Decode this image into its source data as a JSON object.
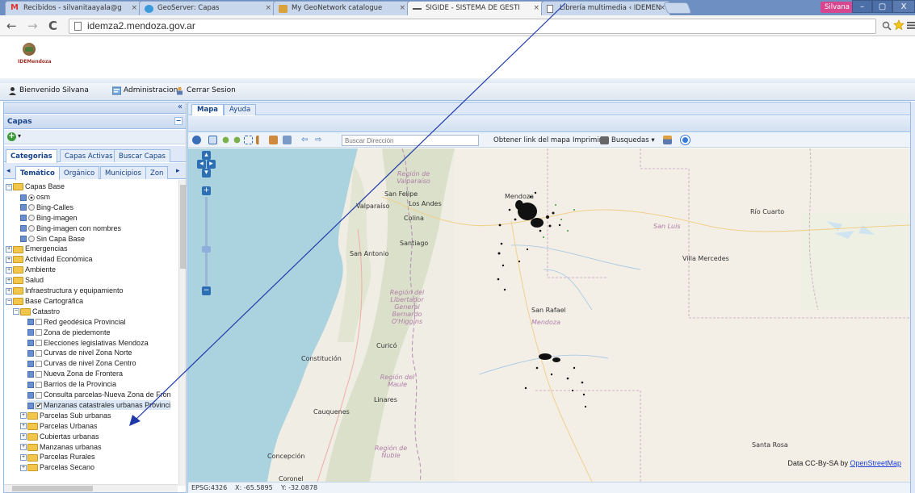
{
  "browser": {
    "tabs": [
      {
        "title": "Recibidos - silvanitaayala@g",
        "icon": "gmail-icon",
        "close": "×"
      },
      {
        "title": "GeoServer: Capas",
        "icon": "geoserver-icon",
        "close": "×"
      },
      {
        "title": "My GeoNetwork catalogue",
        "icon": "geonetwork-icon",
        "close": "×"
      },
      {
        "title": "SIGIDE - SISTEMA DE GESTI",
        "icon": "sigide-icon",
        "close": "×"
      },
      {
        "title": "Librería multimedia ‹ IDEMEN",
        "icon": "page-icon",
        "close": "×"
      }
    ],
    "user_chip": "Silvana",
    "window_buttons": [
      "–",
      "▢",
      "X"
    ],
    "nav": {
      "back": "←",
      "forward": "→",
      "reload": "C"
    },
    "url": "idemza2.mendoza.gov.ar",
    "url_right_icons": [
      "zoom-icon",
      "star-icon",
      "menu-icon"
    ]
  },
  "app": {
    "logo_text": "IDEMendoza",
    "userbar": {
      "welcome": "Bienvenido Silvana",
      "admin": "Administracion",
      "logout": "Cerrar Sesion"
    }
  },
  "left": {
    "collapse_glyph": "«",
    "title": "Capas",
    "min_glyph": "−",
    "add_glyph": "+",
    "add_arrow": "▾",
    "tabs": [
      "Categorias",
      "Capas Activas",
      "Buscar Capas"
    ],
    "subtabs": [
      "Temático",
      "Orgánico",
      "Municipios",
      "Zon"
    ],
    "tree": [
      {
        "indent": 0,
        "type": "folder",
        "pm": "−",
        "label": "Capas Base"
      },
      {
        "indent": 2,
        "type": "radio",
        "on": true,
        "label": "osm"
      },
      {
        "indent": 2,
        "type": "radio",
        "on": false,
        "label": "Bing-Calles"
      },
      {
        "indent": 2,
        "type": "radio",
        "on": false,
        "label": "Bing-imagen"
      },
      {
        "indent": 2,
        "type": "radio",
        "on": false,
        "label": "Bing-imagen con nombres"
      },
      {
        "indent": 2,
        "type": "radio",
        "on": false,
        "label": "Sin Capa Base"
      },
      {
        "indent": 0,
        "type": "folder",
        "pm": "+",
        "label": "Emergencias"
      },
      {
        "indent": 0,
        "type": "folder",
        "pm": "+",
        "label": "Actividad Económica"
      },
      {
        "indent": 0,
        "type": "folder",
        "pm": "+",
        "label": "Ambiente"
      },
      {
        "indent": 0,
        "type": "folder",
        "pm": "+",
        "label": "Salud"
      },
      {
        "indent": 0,
        "type": "folder",
        "pm": "+",
        "label": "Infraestructura y equipamiento"
      },
      {
        "indent": 0,
        "type": "folder",
        "pm": "−",
        "label": "Base Cartográfica"
      },
      {
        "indent": 1,
        "type": "folder",
        "pm": "−",
        "label": "Catastro"
      },
      {
        "indent": 3,
        "type": "check",
        "on": false,
        "label": "Red geodésica Provincial"
      },
      {
        "indent": 3,
        "type": "check",
        "on": false,
        "label": "Zona de piedemonte"
      },
      {
        "indent": 3,
        "type": "check",
        "on": false,
        "label": "Elecciones legislativas Mendoza"
      },
      {
        "indent": 3,
        "type": "check",
        "on": false,
        "label": "Curvas de nivel Zona Norte"
      },
      {
        "indent": 3,
        "type": "check",
        "on": false,
        "label": "Curvas de nivel Zona Centro"
      },
      {
        "indent": 3,
        "type": "check",
        "on": false,
        "label": "Nueva Zona de Frontera"
      },
      {
        "indent": 3,
        "type": "check",
        "on": false,
        "label": "Barrios de la Provincia"
      },
      {
        "indent": 3,
        "type": "check",
        "on": false,
        "label": "Consulta parcelas-Nueva Zona de Fron"
      },
      {
        "indent": 3,
        "type": "check",
        "on": true,
        "label": "Manzanas catastrales urbanas Provinci"
      },
      {
        "indent": 2,
        "type": "folder",
        "pm": "+",
        "label": "Parcelas Sub urbanas"
      },
      {
        "indent": 2,
        "type": "folder",
        "pm": "+",
        "label": "Parcelas Urbanas"
      },
      {
        "indent": 2,
        "type": "folder",
        "pm": "+",
        "label": "Cubiertas urbanas"
      },
      {
        "indent": 2,
        "type": "folder",
        "pm": "+",
        "label": "Manzanas urbanas"
      },
      {
        "indent": 2,
        "type": "folder",
        "pm": "+",
        "label": "Parcelas Rurales"
      },
      {
        "indent": 2,
        "type": "folder",
        "pm": "+",
        "label": "Parcelas Secano"
      }
    ]
  },
  "map": {
    "tabs": [
      "Mapa",
      "Ayuda"
    ],
    "search_placeholder": "Buscar Dirección",
    "toolbar_text": {
      "link": "Obtener link del mapa",
      "print": "Imprimir",
      "search_menu": "Busquedas",
      "search_arrow": "▾"
    },
    "zoom": {
      "in": "+",
      "out": "−"
    },
    "labels": [
      {
        "text": "Región de Valparaíso",
        "kind": "reg"
      },
      {
        "text": "San Felipe",
        "kind": "city"
      },
      {
        "text": "Los Andes",
        "kind": "city"
      },
      {
        "text": "Valparaíso",
        "kind": "city"
      },
      {
        "text": "Colina",
        "kind": "city"
      },
      {
        "text": "Santiago",
        "kind": "city"
      },
      {
        "text": "San Antonio",
        "kind": "city"
      },
      {
        "text": "Región del Libertador General Bernardo O'Higgins",
        "kind": "reg"
      },
      {
        "text": "Mendoza",
        "kind": "city"
      },
      {
        "text": "San Luis",
        "kind": "sl"
      },
      {
        "text": "Río Cuarto",
        "kind": "city"
      },
      {
        "text": "Villa Mercedes",
        "kind": "city"
      },
      {
        "text": "San Rafael",
        "kind": "city"
      },
      {
        "text": "Mendoza",
        "kind": "sl"
      },
      {
        "text": "Curicó",
        "kind": "city"
      },
      {
        "text": "Constitución",
        "kind": "city"
      },
      {
        "text": "Región del Maule",
        "kind": "reg"
      },
      {
        "text": "Linares",
        "kind": "city"
      },
      {
        "text": "Cauquenes",
        "kind": "city"
      },
      {
        "text": "Región de Ñuble",
        "kind": "reg"
      },
      {
        "text": "Concepción",
        "kind": "city"
      },
      {
        "text": "Santa Rosa",
        "kind": "city"
      },
      {
        "text": "Coronel",
        "kind": "city"
      }
    ],
    "attribution_prefix": "Data CC-By-SA by ",
    "attribution_link": "OpenStreetMap",
    "status": {
      "epsg": "EPSG:4326",
      "x": "X: -65.5895",
      "y": "Y: -32.0878"
    }
  }
}
